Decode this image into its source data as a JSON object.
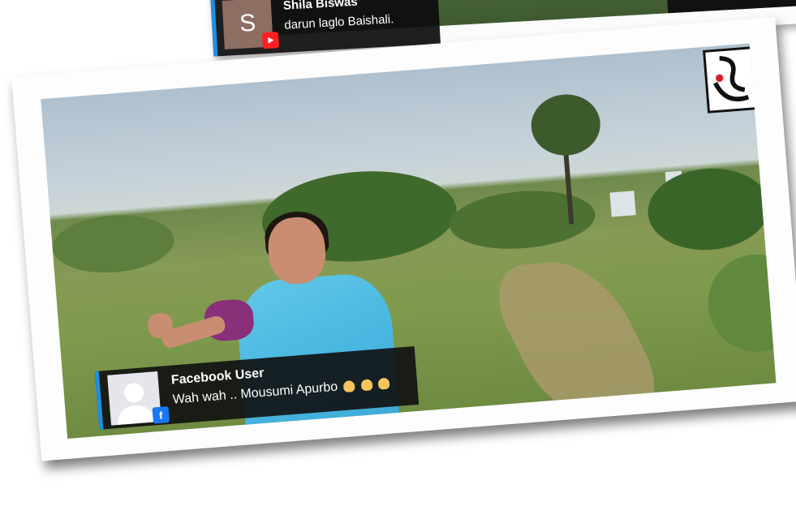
{
  "back_card": {
    "comment": {
      "author": "Shila Biswas",
      "text": "darun laglo Baishali.",
      "avatar_letter": "S",
      "platform_icon": "youtube-icon"
    }
  },
  "front_card": {
    "comment": {
      "author": "Facebook User",
      "text": "Wah wah .. Mousumi Apurbo",
      "emoji": "clapping-hands-emoji",
      "emoji_count": 3,
      "platform_icon": "facebook-icon"
    },
    "logo": "channel-logo"
  },
  "colors": {
    "overlay_bg": "#0f0f0f",
    "accent_bar": "#1d8fe6",
    "youtube_red": "#ff1f1f",
    "facebook_blue": "#1877f2"
  }
}
